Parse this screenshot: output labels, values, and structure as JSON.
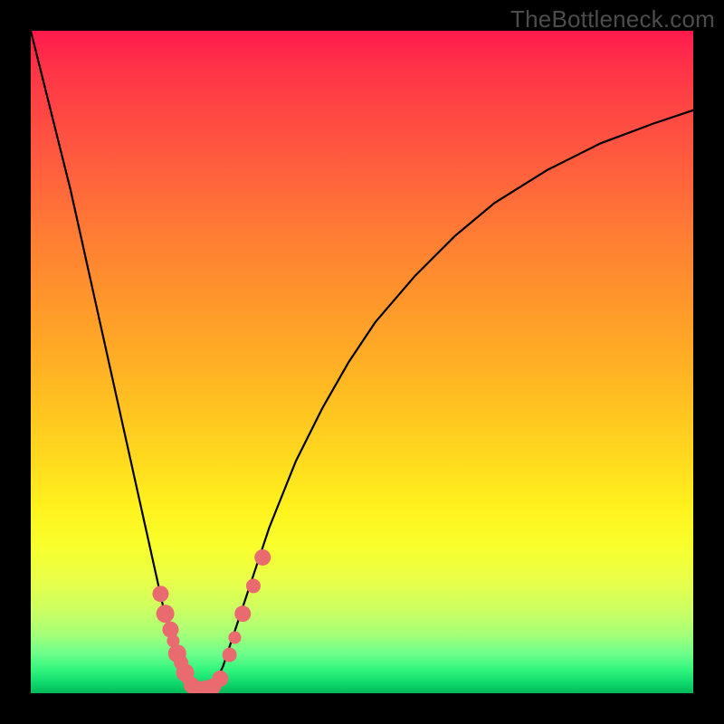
{
  "watermark": "TheBottleneck.com",
  "chart_data": {
    "type": "line",
    "title": "",
    "xlabel": "",
    "ylabel": "",
    "xlim": [
      0,
      1
    ],
    "ylim": [
      0,
      1
    ],
    "background": "rainbow-gradient",
    "series": [
      {
        "name": "bottleneck-curve",
        "color": "#000000",
        "x": [
          0.0,
          0.02,
          0.04,
          0.06,
          0.08,
          0.1,
          0.12,
          0.14,
          0.16,
          0.18,
          0.2,
          0.22,
          0.23,
          0.24,
          0.25,
          0.26,
          0.27,
          0.28,
          0.29,
          0.3,
          0.32,
          0.34,
          0.36,
          0.38,
          0.4,
          0.44,
          0.48,
          0.52,
          0.58,
          0.64,
          0.7,
          0.78,
          0.86,
          0.94,
          1.0
        ],
        "y": [
          1.0,
          0.92,
          0.84,
          0.76,
          0.67,
          0.58,
          0.49,
          0.4,
          0.31,
          0.22,
          0.13,
          0.05,
          0.02,
          0.01,
          0.005,
          0.005,
          0.01,
          0.02,
          0.04,
          0.07,
          0.13,
          0.19,
          0.25,
          0.3,
          0.35,
          0.43,
          0.5,
          0.56,
          0.63,
          0.69,
          0.74,
          0.79,
          0.83,
          0.86,
          0.88
        ]
      }
    ],
    "points": {
      "name": "sample-dots",
      "color": "#e96a6f",
      "x": [
        0.196,
        0.203,
        0.211,
        0.215,
        0.221,
        0.227,
        0.233,
        0.237,
        0.243,
        0.249,
        0.255,
        0.266,
        0.275,
        0.286,
        0.3,
        0.308,
        0.32,
        0.336,
        0.35
      ],
      "y": [
        0.15,
        0.12,
        0.096,
        0.079,
        0.06,
        0.046,
        0.031,
        0.022,
        0.012,
        0.008,
        0.006,
        0.006,
        0.01,
        0.022,
        0.058,
        0.084,
        0.12,
        0.162,
        0.205
      ],
      "r": [
        9,
        10,
        9,
        7,
        10,
        8,
        10,
        7,
        9,
        8,
        9,
        10,
        9,
        9,
        8,
        7,
        9,
        8,
        9
      ]
    }
  }
}
